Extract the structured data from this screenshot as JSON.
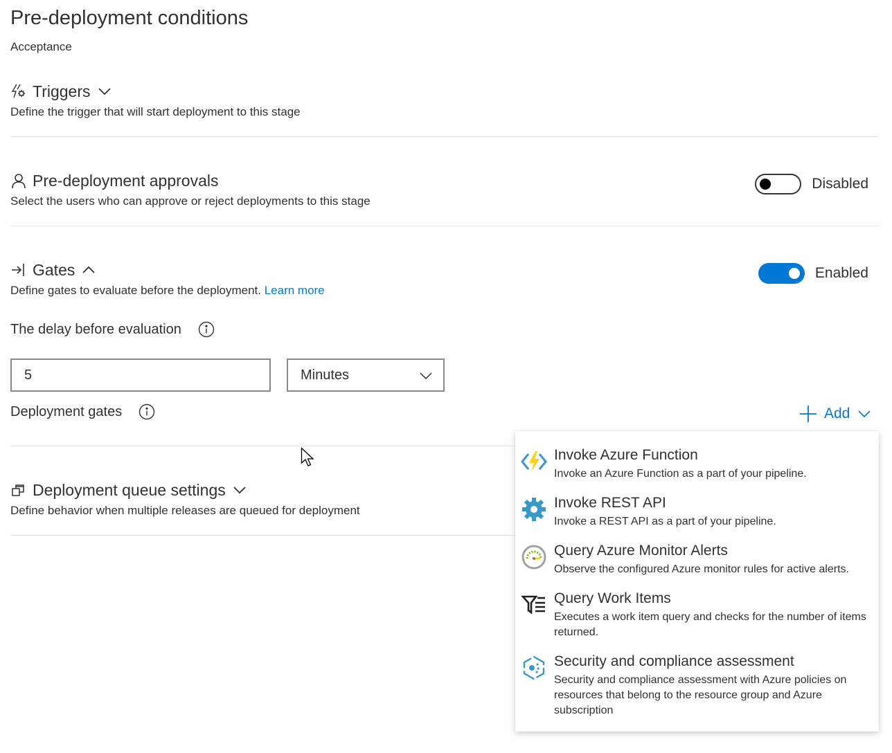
{
  "header": {
    "title": "Pre-deployment conditions",
    "subtitle": "Acceptance"
  },
  "triggers": {
    "icon": "lightning-gear-icon",
    "title": "Triggers",
    "description": "Define the trigger that will start deployment to this stage"
  },
  "approvals": {
    "icon": "person-icon",
    "title": "Pre-deployment approvals",
    "description": "Select the users who can approve or reject deployments to this stage",
    "toggle_label": "Disabled",
    "enabled": false
  },
  "gates": {
    "icon": "enter-arrow-icon",
    "title": "Gates",
    "description": "Define gates to evaluate before the deployment.",
    "learn_more": "Learn more",
    "toggle_label": "Enabled",
    "enabled": true,
    "delay_label": "The delay before evaluation",
    "delay_value": "5",
    "delay_unit": "Minutes",
    "deployment_gates_label": "Deployment gates",
    "add_label": "Add"
  },
  "queue": {
    "icon": "stacked-windows-icon",
    "title": "Deployment queue settings",
    "description": "Define behavior when multiple releases are queued for deployment"
  },
  "add_menu": {
    "items": [
      {
        "icon": "azure-function-icon",
        "title": "Invoke Azure Function",
        "description": "Invoke an Azure Function as a part of your pipeline."
      },
      {
        "icon": "rest-api-gear-icon",
        "title": "Invoke REST API",
        "description": "Invoke a REST API as a part of your pipeline."
      },
      {
        "icon": "monitor-gauge-icon",
        "title": "Query Azure Monitor Alerts",
        "description": "Observe the configured Azure monitor rules for active alerts."
      },
      {
        "icon": "work-items-query-icon",
        "title": "Query Work Items",
        "description": "Executes a work item query and checks for the number of items returned."
      },
      {
        "icon": "security-assessment-icon",
        "title": "Security and compliance assessment",
        "description": "Security and compliance assessment with Azure policies on resources that belong to the resource group and Azure subscription"
      }
    ]
  },
  "colors": {
    "accent": "#0078d4",
    "text": "#323130",
    "divider": "#e6e6e6"
  }
}
